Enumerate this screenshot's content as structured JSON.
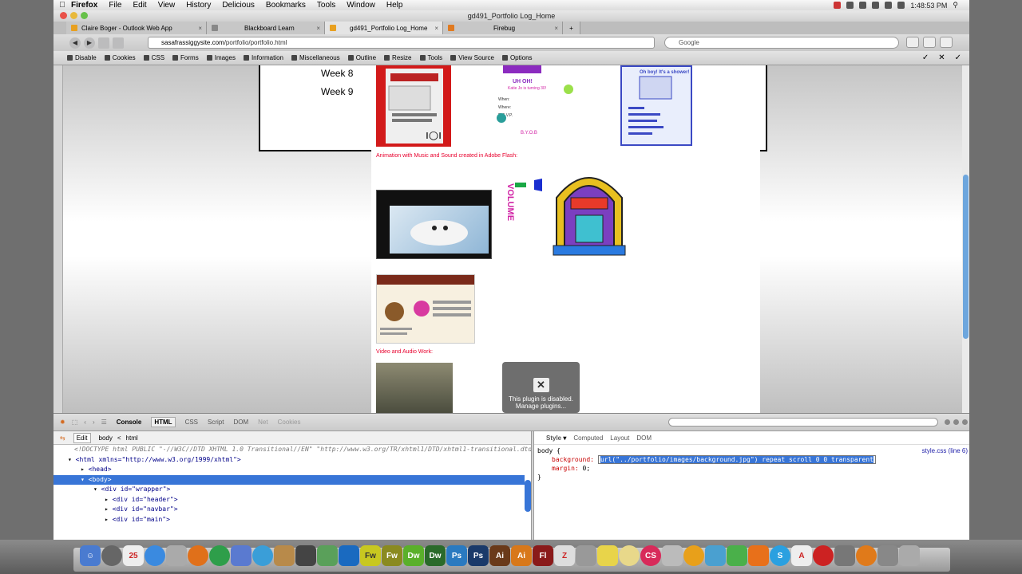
{
  "menubar": {
    "app": "Firefox",
    "items": [
      "File",
      "Edit",
      "View",
      "History",
      "Delicious",
      "Bookmarks",
      "Tools",
      "Window",
      "Help"
    ],
    "clock": "1:48:53 PM"
  },
  "window": {
    "title": "gd491_Portfolio Log_Home"
  },
  "tabs": [
    {
      "label": "Claire Boger - Outlook Web App"
    },
    {
      "label": "Blackboard Learn"
    },
    {
      "label": "gd491_Portfolio Log_Home"
    },
    {
      "label": "Firebug"
    }
  ],
  "nav": {
    "url_host": "sasafrassiggysite.com",
    "url_path": "/portfolio/portfolio.html",
    "search_placeholder": "Google"
  },
  "devtoolbar": {
    "items": [
      "Disable",
      "Cookies",
      "CSS",
      "Forms",
      "Images",
      "Information",
      "Miscellaneous",
      "Outline",
      "Resize",
      "Tools",
      "View Source",
      "Options"
    ]
  },
  "page": {
    "weeks": [
      "Week 8",
      "Week 9"
    ],
    "captions": {
      "animation": "Animation with Music and Sound created in Adobe Flash:",
      "video": "Video and Audio Work:"
    },
    "volume_label": "VOLUME",
    "plugin": {
      "line1": "This plugin is disabled.",
      "line2": "Manage plugins..."
    },
    "invite_line1": "UH OH!",
    "invite_line2": "Katie Jo is turning 30!",
    "invite_rsvp": "R.S.V.P.",
    "invite_byob": "B.Y.O.B",
    "shower": "Oh boy! It's a shower!",
    "when": "When:",
    "where": "Where:"
  },
  "firebug": {
    "tabs": [
      "Console",
      "HTML",
      "CSS",
      "Script",
      "DOM",
      "Net",
      "Cookies"
    ],
    "sub": {
      "edit": "Edit",
      "crumbs": [
        "body",
        "<",
        "html"
      ]
    },
    "style_tabs": [
      "Style",
      "Computed",
      "Layout",
      "DOM"
    ],
    "style_source": "style.css (line 6)",
    "html_lines": {
      "doctype": "<!DOCTYPE html PUBLIC \"-//W3C//DTD XHTML 1.0 Transitional//EN\" \"http://www.w3.org/TR/xhtml1/DTD/xhtml1-transitional.dtd\">",
      "html_open": "<html xmlns=\"http://www.w3.org/1999/xhtml\">",
      "head": "<head>",
      "body": "<body>",
      "wrapper": "<div id=\"wrapper\">",
      "header": "<div id=\"header\">",
      "navbar": "<div id=\"navbar\">",
      "main": "<div id=\"main\">"
    },
    "css": {
      "selector": "body {",
      "prop1": "background:",
      "value1": "url(\"../portfolio/images/background.jpg\") repeat scroll 0 0 transparent",
      "prop2": "margin:",
      "value2": "0;",
      "close": "}"
    }
  },
  "dock": [
    "Fw",
    "Fw",
    "Dw",
    "Dw",
    "Ps",
    "Ps",
    "Ai",
    "Ai",
    "Fl"
  ]
}
